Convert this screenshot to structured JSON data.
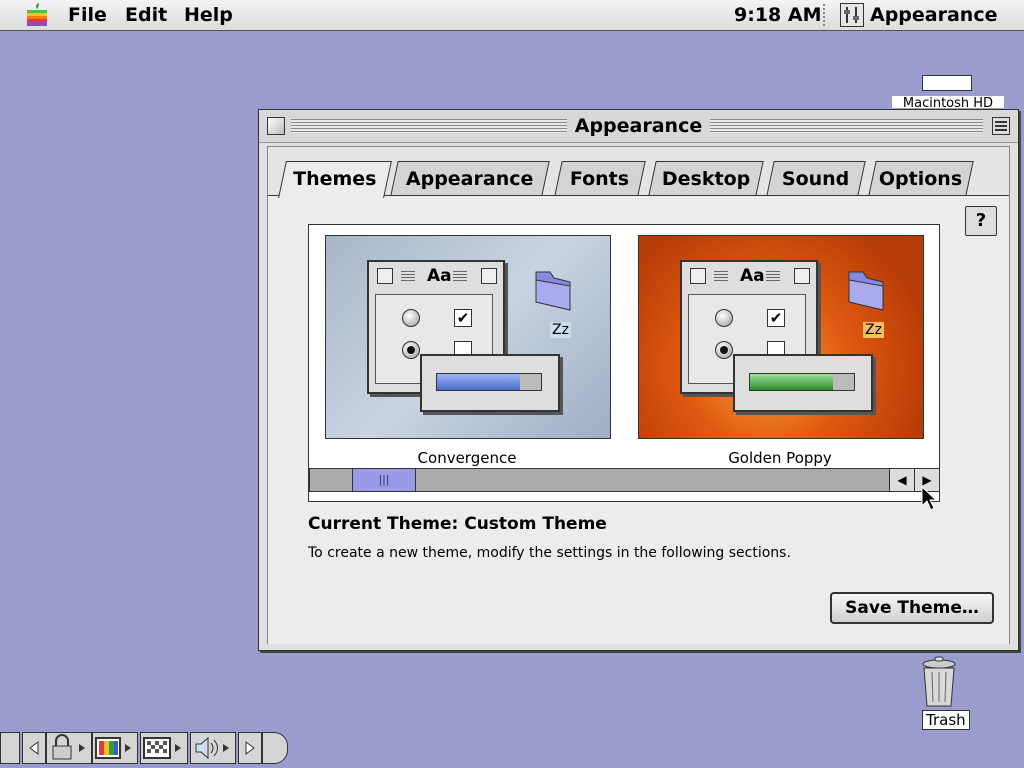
{
  "menubar": {
    "items": [
      "File",
      "Edit",
      "Help"
    ],
    "clock": "9:18 AM",
    "app_name": "Appearance"
  },
  "desktop": {
    "hd_label": "Macintosh HD",
    "trash_label": "Trash"
  },
  "window": {
    "title": "Appearance",
    "tabs": [
      "Themes",
      "Appearance",
      "Fonts",
      "Desktop",
      "Sound",
      "Options"
    ],
    "active_tab": "Themes",
    "help_label": "?",
    "themes": [
      {
        "name": "Convergence",
        "sample_text": "Aa",
        "folder_label": "Zz",
        "bar_color": "#5b7fd8"
      },
      {
        "name": "Golden Poppy",
        "sample_text": "Aa",
        "folder_label": "Zz",
        "bar_color": "#2e9a2e"
      }
    ],
    "current_theme": "Current Theme: Custom Theme",
    "description": "To create a new theme, modify the settings in the following sections.",
    "save_button": "Save Theme…"
  },
  "colors": {
    "desktop": "#9a9ccd",
    "scroll_thumb": "#9a9ae8",
    "poppy": "#e05a10"
  }
}
